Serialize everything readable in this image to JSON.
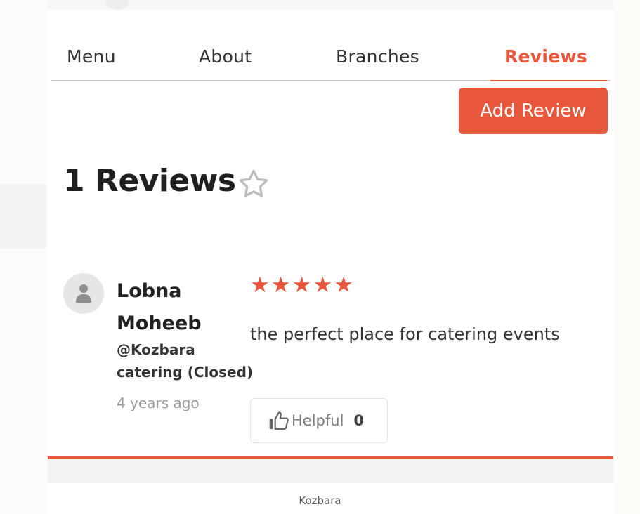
{
  "tabs": [
    {
      "label": "Menu",
      "active": false
    },
    {
      "label": "About",
      "active": false
    },
    {
      "label": "Branches",
      "active": false
    },
    {
      "label": "Reviews",
      "active": true
    }
  ],
  "add_review_label": "Add Review",
  "reviews_heading": "1 Reviews",
  "review": {
    "name": "Lobna Moheeb",
    "branch": "@Kozbara catering (Closed)",
    "time": "4 years ago",
    "rating": 5,
    "text": "the perfect place for catering events",
    "helpful_label": "Helpful",
    "helpful_count": "0"
  },
  "caption": "Kozbara",
  "colors": {
    "accent": "#e8563b",
    "tab_divider": "#c9c9c9",
    "muted_text": "#9c9c9c"
  },
  "icons": {
    "heading_star": "star-outline-icon",
    "avatar": "user-icon",
    "rating_star": "star-filled-icon",
    "helpful": "thumbs-up-icon"
  }
}
